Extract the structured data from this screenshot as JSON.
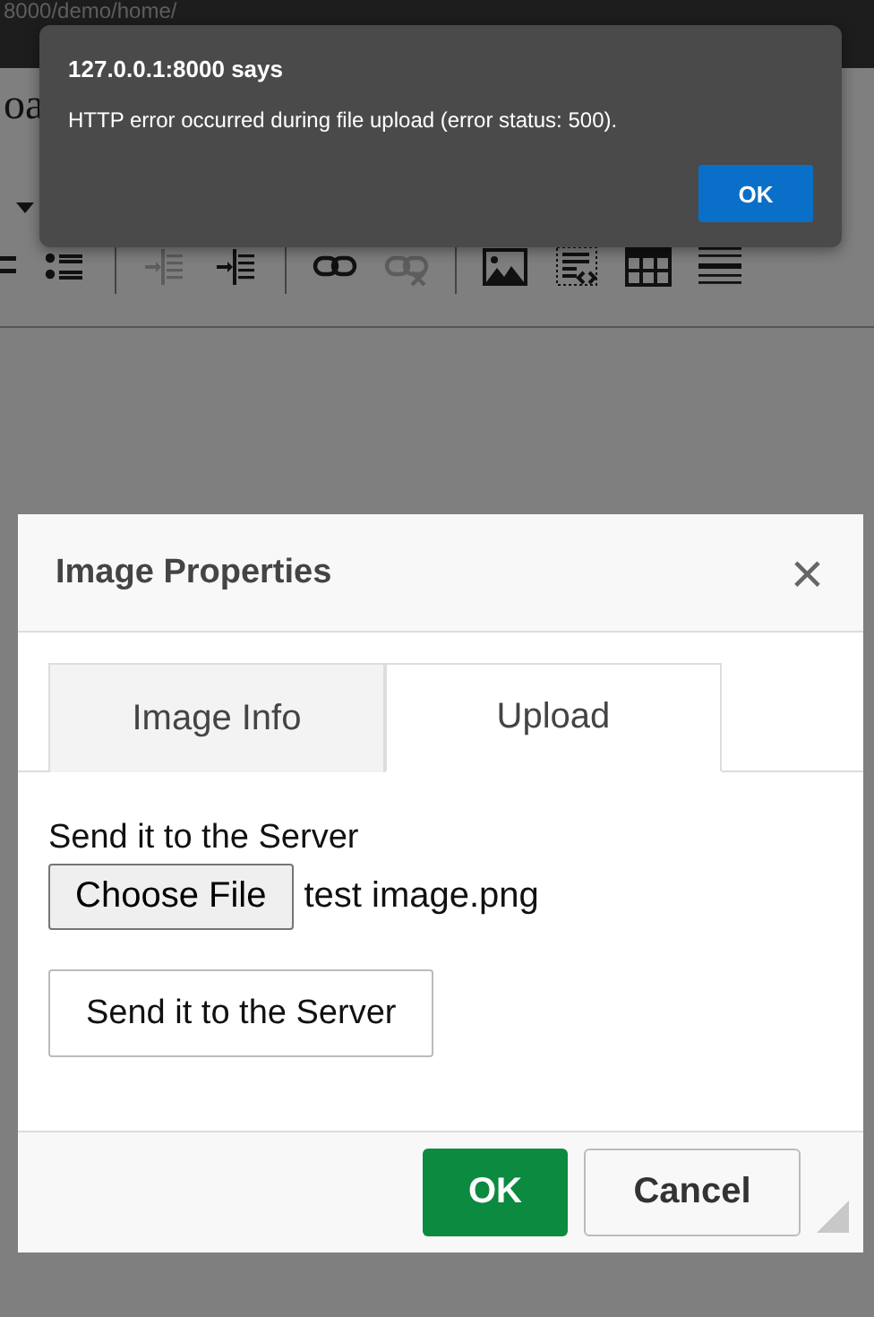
{
  "browser": {
    "address": "8000/demo/home/"
  },
  "page": {
    "heading_fragment": "oa"
  },
  "toolbar": [
    {
      "items": [
        {
          "kind": "list",
          "disabled": false
        },
        {
          "kind": "bullets",
          "disabled": false
        }
      ]
    },
    {
      "items": [
        {
          "kind": "outdent",
          "disabled": true
        },
        {
          "kind": "indent",
          "disabled": false
        }
      ]
    },
    {
      "items": [
        {
          "kind": "link",
          "disabled": false
        },
        {
          "kind": "unlink",
          "disabled": true
        }
      ]
    },
    {
      "items": [
        {
          "kind": "image",
          "disabled": false
        },
        {
          "kind": "template",
          "disabled": false
        },
        {
          "kind": "table",
          "disabled": false
        },
        {
          "kind": "hline",
          "disabled": false
        }
      ]
    }
  ],
  "alert": {
    "title": "127.0.0.1:8000 says",
    "message": "HTTP error occurred during file upload (error status: 500).",
    "button": "OK"
  },
  "dialog": {
    "title": "Image Properties",
    "close": "×",
    "tabs": [
      {
        "label": "Image Info",
        "selected": false
      },
      {
        "label": "Upload",
        "selected": true
      }
    ],
    "upload_label": "Send it to the Server",
    "file_button": "Choose File",
    "file_name": "test image.png",
    "send_button": "Send it to the Server",
    "ok": "OK",
    "cancel": "Cancel"
  }
}
